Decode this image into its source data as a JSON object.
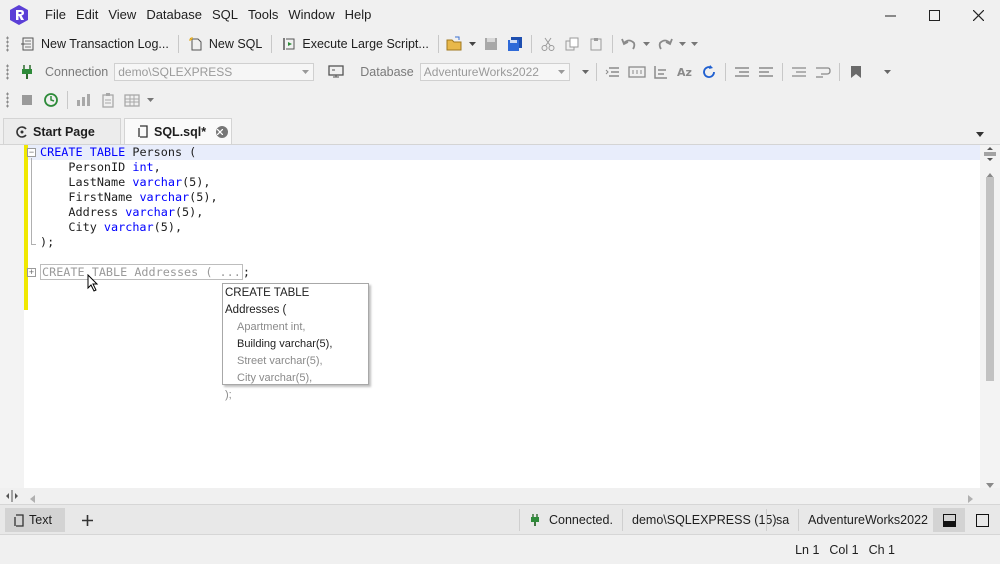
{
  "menu": [
    "File",
    "Edit",
    "View",
    "Database",
    "SQL",
    "Tools",
    "Window",
    "Help"
  ],
  "toolbar": {
    "new_transaction_log": "New Transaction Log...",
    "new_sql": "New SQL",
    "execute_large_script": "Execute Large Script...",
    "connection_label": "Connection",
    "connection_value": "demo\\SQLEXPRESS",
    "database_label": "Database",
    "database_value": "AdventureWorks2022"
  },
  "tabs": [
    {
      "label": "Start Page",
      "active": false
    },
    {
      "label": "SQL.sql*",
      "active": true
    }
  ],
  "editor": {
    "lines": [
      {
        "t": [
          [
            "kw",
            "CREATE"
          ],
          [
            "id",
            " "
          ],
          [
            "kw",
            "TABLE"
          ],
          [
            "id",
            " Persons ("
          ]
        ]
      },
      {
        "t": [
          [
            "id",
            "    PersonID "
          ],
          [
            "ty",
            "int"
          ],
          [
            "id",
            ","
          ]
        ]
      },
      {
        "t": [
          [
            "id",
            "    LastName "
          ],
          [
            "ty",
            "varchar"
          ],
          [
            "id",
            "(5),"
          ]
        ]
      },
      {
        "t": [
          [
            "id",
            "    FirstName "
          ],
          [
            "ty",
            "varchar"
          ],
          [
            "id",
            "(5),"
          ]
        ]
      },
      {
        "t": [
          [
            "id",
            "    Address "
          ],
          [
            "ty",
            "varchar"
          ],
          [
            "id",
            "(5),"
          ]
        ]
      },
      {
        "t": [
          [
            "id",
            "    City "
          ],
          [
            "ty",
            "varchar"
          ],
          [
            "id",
            "(5),"
          ]
        ]
      },
      {
        "t": [
          [
            "id",
            ");"
          ]
        ]
      },
      {
        "t": [
          [
            "id",
            ""
          ]
        ]
      }
    ],
    "collapsed_text": "CREATE TABLE Addresses ( ...",
    "collapsed_suffix": ";"
  },
  "tooltip": {
    "head": "CREATE TABLE Addresses (",
    "lines": [
      {
        "text": "Apartment int,",
        "hl": false
      },
      {
        "text": "Building varchar(5),",
        "hl": true
      },
      {
        "text": "Street varchar(5),",
        "hl": false
      },
      {
        "text": "City varchar(5),",
        "hl": false
      }
    ],
    "tail": ");"
  },
  "bottom": {
    "tab_label": "Text",
    "status": "Connected.",
    "server": "demo\\SQLEXPRESS (15)",
    "user": "sa",
    "database": "AdventureWorks2022"
  },
  "statusbar": {
    "ln": "Ln 1",
    "col": "Col 1",
    "ch": "Ch 1"
  },
  "colors": {
    "accent": "#5b3fd6",
    "keyword": "#0000ff",
    "change_bar": "#f0e800",
    "connected": "#2e8b3a"
  }
}
